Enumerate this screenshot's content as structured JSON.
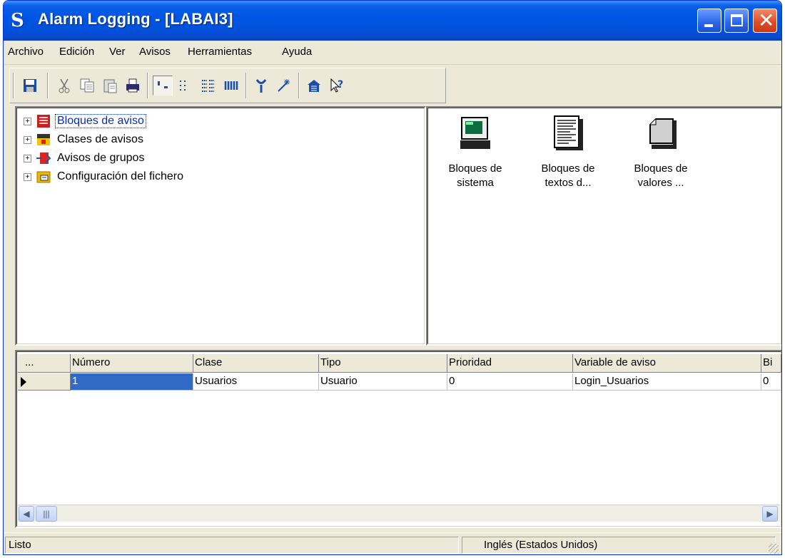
{
  "window": {
    "title": "Alarm Logging - [LABAI3]",
    "colors": {
      "titlebar": "#0055e5",
      "selection": "#3169c6",
      "tree_selected_text": "#0a2bb4"
    }
  },
  "menubar": {
    "items": [
      "Archivo",
      "Edición",
      "Ver",
      "Avisos",
      "Herramientas",
      "Ayuda"
    ]
  },
  "toolbar": {
    "icons": [
      "save-icon",
      "cut-icon",
      "copy-icon",
      "paste-icon",
      "print-icon",
      "large-icons-view-icon",
      "small-icons-view-icon",
      "list-view-icon",
      "details-view-icon",
      "properties-icon",
      "wizard-icon",
      "import-icon",
      "context-help-icon"
    ]
  },
  "tree": {
    "items": [
      {
        "label": "Bloques de aviso",
        "icon": "message-blocks-icon",
        "selected": true
      },
      {
        "label": "Clases de avisos",
        "icon": "message-classes-icon",
        "selected": false
      },
      {
        "label": "Avisos de grupos",
        "icon": "group-messages-icon",
        "selected": false
      },
      {
        "label": "Configuración del fichero",
        "icon": "archive-config-icon",
        "selected": false
      }
    ]
  },
  "icon_view": {
    "items": [
      {
        "line1": "Bloques de",
        "line2": "sistema",
        "icon": "computer-icon"
      },
      {
        "line1": "Bloques de",
        "line2": "textos d...",
        "icon": "text-document-icon"
      },
      {
        "line1": "Bloques de",
        "line2": "valores ...",
        "icon": "values-block-icon"
      }
    ]
  },
  "grid": {
    "corner": "...",
    "columns": [
      "Número",
      "Clase",
      "Tipo",
      "Prioridad",
      "Variable de aviso",
      "Bi"
    ],
    "rows": [
      [
        "1",
        "Usuarios",
        "Usuario",
        "0",
        "Login_Usuarios",
        "0"
      ]
    ]
  },
  "statusbar": {
    "status": "Listo",
    "language": "Inglés (Estados Unidos)"
  }
}
